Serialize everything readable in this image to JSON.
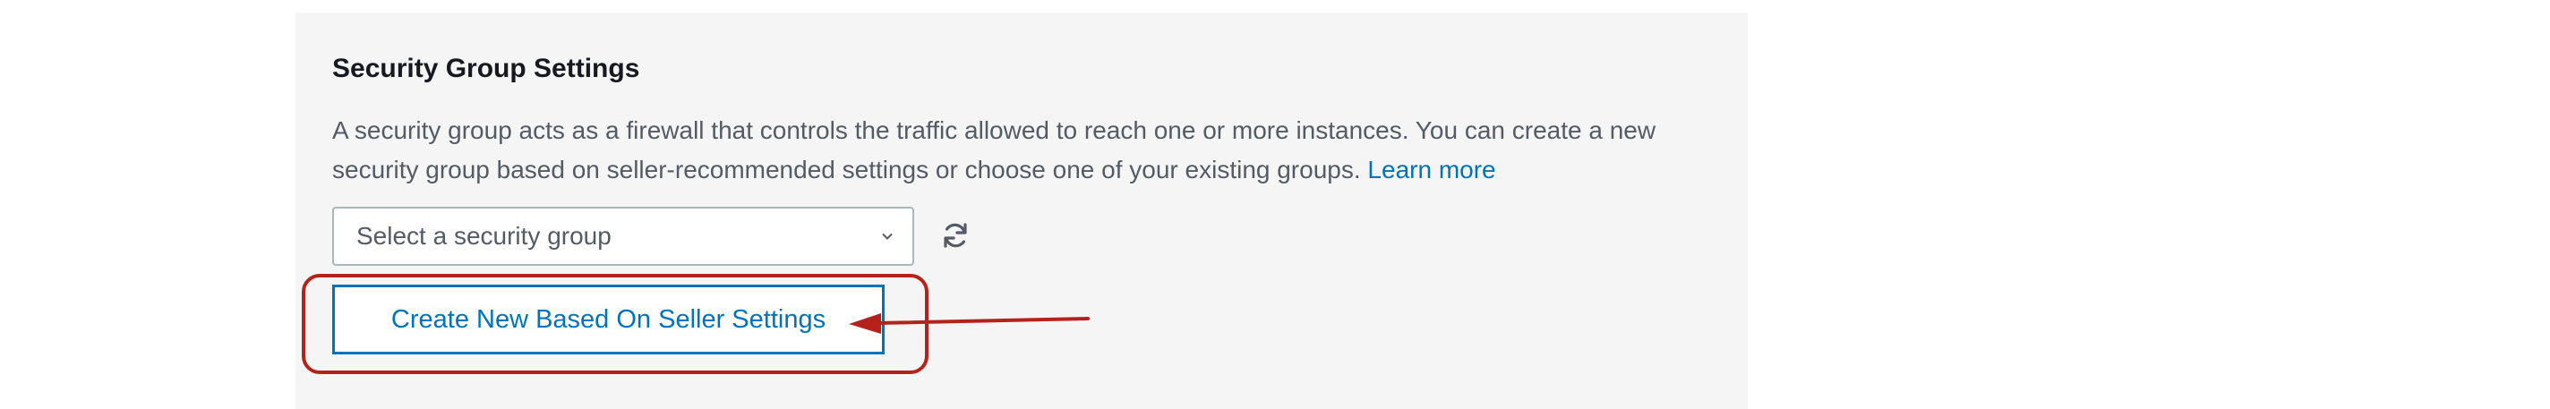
{
  "section": {
    "title": "Security Group Settings",
    "description_line1": "A security group acts as a firewall that controls the traffic allowed to reach one or more instances. You can create a new",
    "description_line2": "security group based on seller-recommended settings or choose one of your existing groups.",
    "learn_more": "Learn more"
  },
  "security_group_select": {
    "selected": "Select a security group"
  },
  "create_button": {
    "label": "Create New Based On Seller Settings"
  },
  "colors": {
    "panel_bg": "#f4f5f4",
    "link": "#0073bb",
    "annotation": "#b3231c"
  },
  "icons": {
    "dropdown": "chevron-down-icon",
    "refresh": "refresh-icon",
    "annotation_arrow": "arrow-left-icon"
  }
}
